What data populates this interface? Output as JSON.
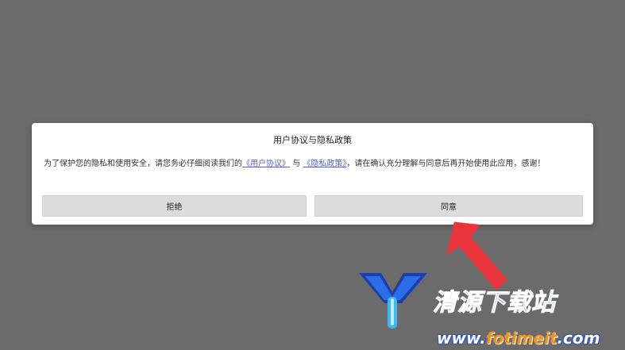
{
  "dialog": {
    "title": "用户协议与隐私政策",
    "body_prefix": "为了保护您的隐私和使用安全，请您务必仔细阅读我们的",
    "link_user_agreement": "《用户协议》",
    "body_and": "与",
    "link_privacy_policy": "《隐私政策》",
    "body_suffix": "，请在确认充分理解与同意后再开始使用此应用，感谢！",
    "reject_label": "拒绝",
    "agree_label": "同意"
  },
  "watermark": {
    "cn_text": "清源下载站",
    "url_prefix": "www.",
    "url_highlight": "fotimeit",
    "url_suffix": ".com"
  },
  "colors": {
    "overlay": "#6b6b6b",
    "link": "#5a62b5",
    "button_bg": "#dcdcdc",
    "arrow": "#e8343a"
  },
  "icons": {
    "arrow": "red-pointer-arrow-icon",
    "logo": "watermark-logo-icon"
  }
}
